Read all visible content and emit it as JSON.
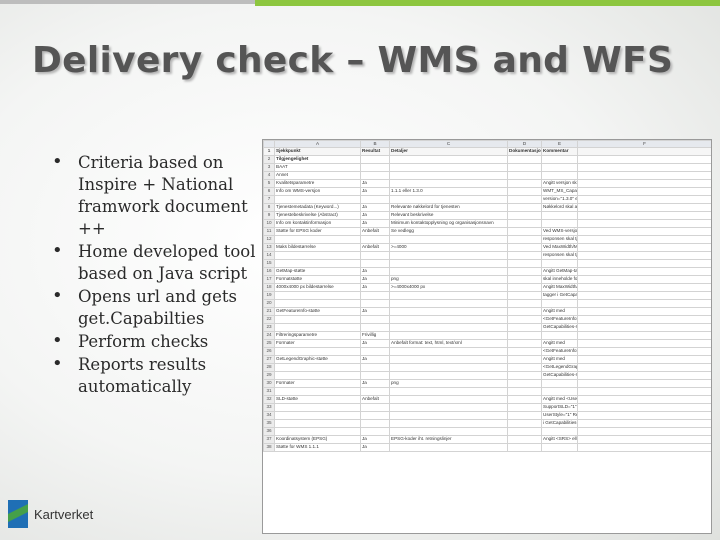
{
  "slide": {
    "title": "Delivery check – WMS and WFS",
    "bullets": [
      "Criteria based on Inspire + National framwork document ++",
      "Home developed tool based on Java script",
      "Opens url and gets get.Capabilties",
      "Perform checks",
      "Reports results automatically"
    ],
    "bullet_icon": "bullet-dot",
    "accent_color": "#8dc63f",
    "logo_text": "Kartverket",
    "logo_colors": [
      "#1f6fb5",
      "#45a04a"
    ]
  },
  "sheet": {
    "columns": [
      "A",
      "B",
      "C",
      "D",
      "E",
      "F"
    ],
    "rows": [
      {
        "n": "1",
        "cells": [
          "Sjekkpunkt",
          "Resultat",
          "Detaljer",
          "Dokumentasjon",
          "Kommentar",
          ""
        ],
        "style": "colh"
      },
      {
        "n": "2",
        "cells": [
          "Tilgjengelighet",
          "",
          "",
          "",
          "",
          ""
        ],
        "style": "sec"
      },
      {
        "n": "3",
        "cells": [
          "BAAT",
          "",
          "",
          "",
          "",
          ""
        ]
      },
      {
        "n": "4",
        "cells": [
          "Annet",
          "",
          "",
          "",
          "",
          ""
        ]
      },
      {
        "n": "5",
        "cells": [
          "Kvalitetsparametre",
          "Ja",
          "",
          "",
          "Angitt versjon skal foreligge",
          ""
        ]
      },
      {
        "n": "6",
        "cells": [
          "Info om WMS-versjon",
          "Ja",
          "1.1.1 eller 1.3.0",
          "",
          "WMT_MS_Capabilities eller WMS_Capabilities",
          ""
        ]
      },
      {
        "n": "7",
        "cells": [
          "",
          "",
          "",
          "",
          "version=\"1.3.0\" eller \"1.1.1\"",
          ""
        ]
      },
      {
        "n": "8",
        "cells": [
          "Tjenestemetadata (Keyword...)",
          "Ja",
          "Relevante nøkkelord for tjenesten",
          "",
          "Nøkkelord skal angis",
          ""
        ]
      },
      {
        "n": "9",
        "cells": [
          "Tjenestebeskrivelse (Abstract)",
          "Ja",
          "Relevant beskrivelse",
          "",
          "",
          ""
        ]
      },
      {
        "n": "10",
        "cells": [
          "Info om kontaktinformasjon",
          "Ja",
          "Minimum kontaktopplysning og organisasjonsnavn",
          "",
          "",
          ""
        ]
      },
      {
        "n": "11",
        "cells": [
          "Støtte for EPSG koder",
          "Anbefalt",
          "Se vedlegg",
          "",
          "Ved WMS-versjon skal lagene angis",
          ""
        ]
      },
      {
        "n": "12",
        "cells": [
          "",
          "",
          "",
          "",
          "responsen skal tjenesten støtte",
          ""
        ]
      },
      {
        "n": "13",
        "cells": [
          "Maks bildestørrelse",
          "Anbefalt",
          ">=4000",
          "",
          "Ved MaxWidth/MaxHeight",
          ""
        ]
      },
      {
        "n": "14",
        "cells": [
          "",
          "",
          "",
          "",
          "responsen skal tjenesten ...",
          ""
        ]
      },
      {
        "n": "15",
        "cells": [
          "",
          "",
          "",
          "",
          "",
          ""
        ]
      },
      {
        "n": "16",
        "cells": [
          "GetMap-støtte",
          "Ja",
          "",
          "",
          "Angitt GetMap-tagg i GetCapabilities-responsen",
          ""
        ]
      },
      {
        "n": "17",
        "cells": [
          "Formatstøtte",
          "Ja",
          "png",
          "",
          "skal inneholde formater",
          ""
        ]
      },
      {
        "n": "18",
        "cells": [
          "4000x4000 px bildestørrelse",
          "Ja",
          ">=4000x4000 px",
          "",
          "Angitt MaxWidth/MaxHeight-taggene",
          ""
        ]
      },
      {
        "n": "19",
        "cells": [
          "",
          "",
          "",
          "",
          "tagger i GetCapabilities-responsen",
          ""
        ]
      },
      {
        "n": "20",
        "cells": [
          "",
          "",
          "",
          "",
          "",
          ""
        ]
      },
      {
        "n": "21",
        "cells": [
          "GetFeatureInfo-støtte",
          "Ja",
          "",
          "",
          "Angitt med",
          ""
        ]
      },
      {
        "n": "22",
        "cells": [
          "",
          "",
          "",
          "",
          "<GetFeatureInfo><Format>text/plain",
          ""
        ]
      },
      {
        "n": "23",
        "cells": [
          "",
          "",
          "",
          "",
          "GetCapabilities-responsen",
          ""
        ]
      },
      {
        "n": "24",
        "cells": [
          "Filtreringsparametre",
          "Frivillig",
          "",
          "",
          "",
          ""
        ]
      },
      {
        "n": "25",
        "cells": [
          "Formater",
          "Ja",
          "Anbefalt format: text, html, text/xml",
          "",
          "Angitt med",
          ""
        ]
      },
      {
        "n": "26",
        "cells": [
          "",
          "",
          "",
          "",
          "<GetFeatureInfo><Format>...</Format>",
          ""
        ]
      },
      {
        "n": "27",
        "cells": [
          "GetLegendGraphic-støtte",
          "Ja",
          "",
          "",
          "Angitt med",
          ""
        ]
      },
      {
        "n": "28",
        "cells": [
          "",
          "",
          "",
          "",
          "<GetLegendGraphic><Format>image/png",
          ""
        ]
      },
      {
        "n": "29",
        "cells": [
          "",
          "",
          "",
          "",
          "GetCapabilities-responsen",
          ""
        ]
      },
      {
        "n": "30",
        "cells": [
          "Formater",
          "Ja",
          "png",
          "",
          "",
          ""
        ]
      },
      {
        "n": "31",
        "cells": [
          "",
          "",
          "",
          "",
          "",
          ""
        ]
      },
      {
        "n": "32",
        "cells": [
          "SLD-støtte",
          "Anbefalt",
          "",
          "",
          "Angitt med <UserDefinedSymbolization",
          ""
        ]
      },
      {
        "n": "33",
        "cells": [
          "",
          "",
          "",
          "",
          "SupportSLD=\"1\" UserLayer=\"1\"",
          ""
        ]
      },
      {
        "n": "34",
        "cells": [
          "",
          "",
          "",
          "",
          "UserStyle=\"1\" RemoteWFS=\"1\"",
          ""
        ]
      },
      {
        "n": "35",
        "cells": [
          "",
          "",
          "",
          "",
          "i GetCapabilities-responsen",
          ""
        ]
      },
      {
        "n": "36",
        "cells": [
          "",
          "",
          "",
          "",
          "",
          ""
        ]
      },
      {
        "n": "37",
        "cells": [
          "Koordinatsystem (EPSG)",
          "Ja",
          "EPSG-koder iht. retningslinjer",
          "",
          "Angitt <SRS> eller <CRS> i GetCapabilities",
          ""
        ]
      },
      {
        "n": "38",
        "cells": [
          "Støtte for WMS 1.1.1",
          "Ja",
          "",
          "",
          "",
          ""
        ]
      }
    ]
  }
}
